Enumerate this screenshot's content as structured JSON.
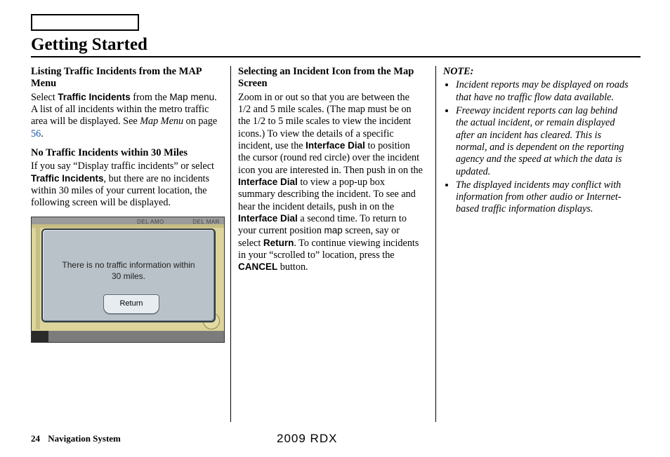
{
  "title": "Getting Started",
  "footer": {
    "page": "24",
    "section": "Navigation System",
    "model": "2009  RDX"
  },
  "col1": {
    "h1": "Listing Traffic Incidents from the MAP Menu",
    "p1_a": "Select ",
    "p1_b": "Traffic Incidents",
    "p1_c": " from the ",
    "p1_d": "Map menu",
    "p1_e": ". A list of all incidents within the metro traffic area will be displayed. See ",
    "p1_f": "Map Menu",
    "p1_g": " on page ",
    "p1_h": "56",
    "p1_i": ".",
    "h2": "No Traffic Incidents within 30 Miles",
    "p2_a": "If you say “Display traffic incidents” or select ",
    "p2_b": "Traffic Incidents",
    "p2_c": ", but there are no incidents within 30 miles of your current location, the following screen will be displayed.",
    "dialog_line1": "There is no traffic information within",
    "dialog_line2": "30 miles.",
    "return_btn": "Return",
    "map_top_left": "DEL AMO",
    "map_top_right": "DEL MAR"
  },
  "col2": {
    "h1": "Selecting an Incident Icon from the Map Screen",
    "p1_a": "Zoom in or out so that you are between the 1/2 and 5 mile scales. (The map must be on the 1/2 to 5 mile scales to view the incident icons.) To view the details of a specific incident, use the ",
    "p1_b": "Interface Dial",
    "p1_c": " to position the cursor (round red circle) over the incident icon you are interested in. Then push in on the ",
    "p1_d": "Interface Dial",
    "p1_e": " to view a pop-up box summary describing the incident. To see and hear the incident details, push in on the ",
    "p1_f": "Interface Dial",
    "p1_g": " a second time. To return to your current position ",
    "p1_h": "map",
    "p1_i": " screen, say or select ",
    "p1_j": "Return",
    "p1_k": ". To continue viewing incidents in your “scrolled to” location, press the ",
    "p1_l": "CANCEL",
    "p1_m": " button."
  },
  "col3": {
    "note_label": "NOTE:",
    "li1": "Incident reports may be displayed on roads that have no traffic flow data available.",
    "li2": "Freeway incident reports can lag behind the actual incident, or remain displayed after an incident has cleared. This is normal, and is dependent on the reporting agency and the speed at which the data is updated.",
    "li3": "The displayed incidents may conflict with information from other audio or Internet-based traffic information displays."
  }
}
